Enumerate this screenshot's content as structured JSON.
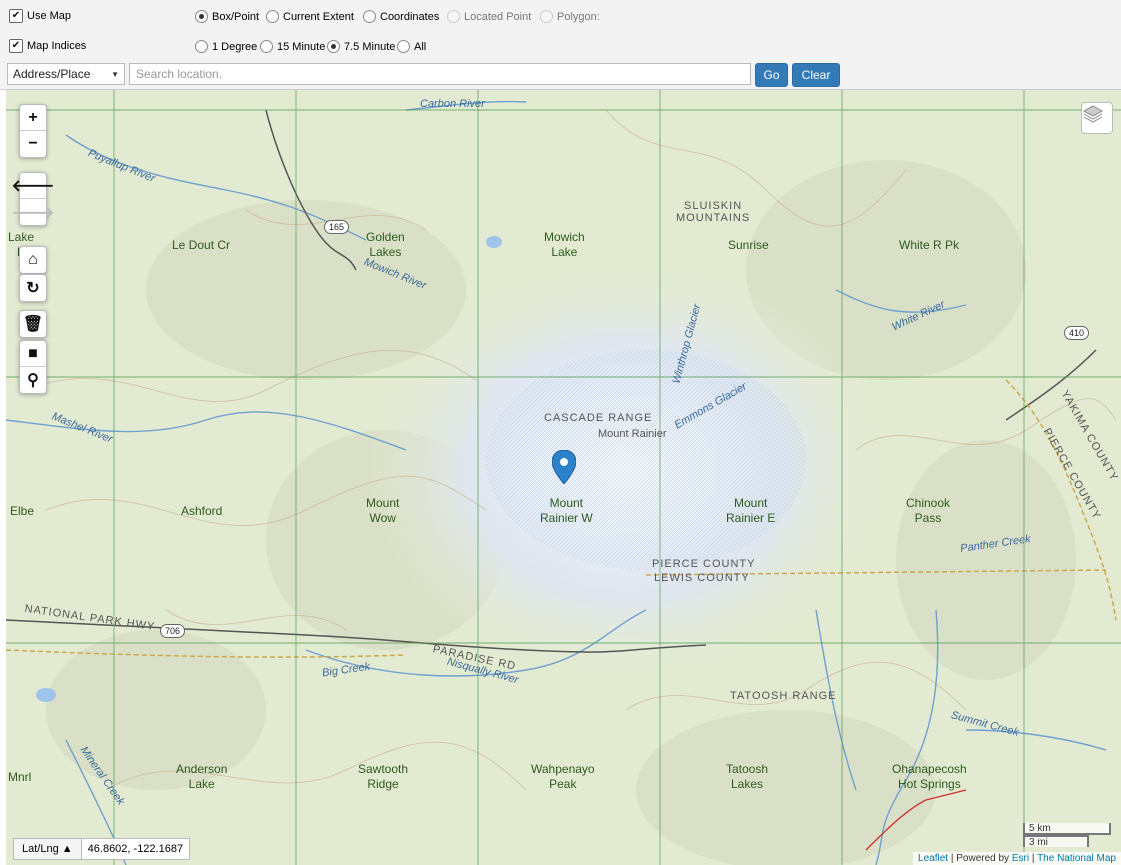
{
  "options": {
    "use_map": {
      "label": "Use Map",
      "checked": true
    },
    "map_indices": {
      "label": "Map Indices",
      "checked": true
    },
    "selection_modes": [
      {
        "label": "Box/Point",
        "selected": true,
        "disabled": false
      },
      {
        "label": "Current Extent",
        "selected": false,
        "disabled": false
      },
      {
        "label": "Coordinates",
        "selected": false,
        "disabled": false
      },
      {
        "label": "Located Point",
        "selected": false,
        "disabled": true
      },
      {
        "label": "Polygon:",
        "selected": false,
        "disabled": true
      }
    ],
    "scales": [
      {
        "label": "1 Degree",
        "selected": false
      },
      {
        "label": "15 Minute",
        "selected": false
      },
      {
        "label": "7.5 Minute",
        "selected": true
      },
      {
        "label": "All",
        "selected": false
      }
    ]
  },
  "search": {
    "type_value": "Address/Place",
    "placeholder": "Search location.",
    "go_label": "Go",
    "clear_label": "Clear"
  },
  "map": {
    "controls": {
      "zoom_in": "+",
      "zoom_out": "−"
    },
    "coords_mode": "Lat/Lng",
    "coords_value": "46.8602, -122.1687",
    "scale_km": "5 km",
    "scale_mi": "3 mi",
    "attribution": {
      "leaflet": "Leaflet",
      "powered": "| Powered by",
      "esri": "Esri",
      "sep": "|",
      "national_map": "The National Map"
    },
    "labels": {
      "lake_k": "Lake\nK",
      "le_dout": "Le Dout Cr",
      "golden_lakes": "Golden\nLakes",
      "mowich_lake": "Mowich\nLake",
      "sunrise": "Sunrise",
      "white_r_pk": "White R Pk",
      "elbe": "Elbe",
      "ashford": "Ashford",
      "mount_wow": "Mount\nWow",
      "mount_rainier_w": "Mount\nRainier W",
      "mount_rainier_e": "Mount\nRainier E",
      "chinook_pass": "Chinook\nPass",
      "mnrl": "Mnrl",
      "anderson_lake": "Anderson\nLake",
      "sawtooth_ridge": "Sawtooth\nRidge",
      "wahpenayo_peak": "Wahpenayo\nPeak",
      "tatoosh_lakes": "Tatoosh\nLakes",
      "ohanapecosh": "Ohanapecosh\nHot Springs"
    },
    "water": {
      "carbon_river": "Carbon River",
      "puyallup_river": "Puyallup River",
      "mowich_river": "Mowich River",
      "white_river": "White River",
      "mashel_river": "Mashel River",
      "big_creek": "Big Creek",
      "nisqually_river": "Nisqually River",
      "summit_creek": "Summit Creek",
      "panther_creek": "Panther Creek",
      "mineral_creek": "Mineral Creek",
      "winthrop_glacier": "Winthrop Glacier",
      "emmons_glacier": "Emmons Glacier"
    },
    "ranges": {
      "sluiskin": "SLUISKIN\nMOUNTAINS",
      "cascade": "CASCADE RANGE",
      "mount_rainier_pt": "Mount Rainier",
      "tatoosh": "TATOOSH RANGE",
      "pierce_county": "PIERCE COUNTY",
      "lewis_county": "LEWIS COUNTY",
      "yakima_county": "YAKIMA COUNTY",
      "pierce_county_v": "PIERCE COUNTY",
      "national_park_hwy": "NATIONAL PARK HWY",
      "paradise_rd": "PARADISE RD"
    },
    "shields": {
      "r165": "165",
      "r410": "410",
      "r706": "706"
    }
  }
}
